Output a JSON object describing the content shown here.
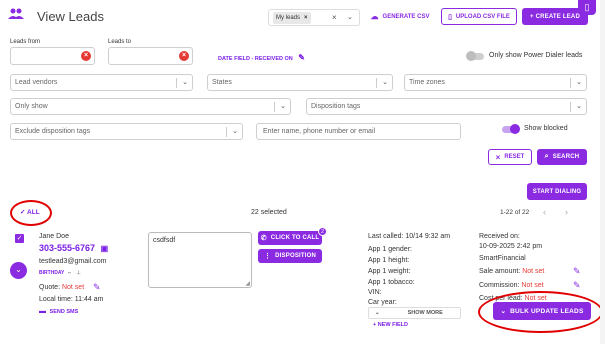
{
  "header": {
    "title": "View Leads",
    "list_chip": "My leads",
    "generate_csv": "GENERATE CSV",
    "upload_csv": "UPLOAD CSV FILE",
    "create_lead": "+ CREATE LEAD"
  },
  "filters": {
    "leads_from_label": "Leads from",
    "leads_to_label": "Leads to",
    "date_field": "DATE FIELD - RECEIVED ON",
    "power_dialer": "Only show Power Dialer leads",
    "lead_vendors": "Lead vendors",
    "states": "States",
    "time_zones": "Time zones",
    "only_show": "Only show",
    "disposition_tags": "Disposition tags",
    "exclude_tags": "Exclude disposition tags",
    "search_placeholder": "Enter name, phone number or email",
    "show_blocked": "Show blocked",
    "reset": "RESET",
    "search": "SEARCH"
  },
  "list": {
    "start_dialing": "START DIALING",
    "all": "ALL",
    "selected": "22 selected",
    "pagination": "1-22 of 22"
  },
  "lead": {
    "name": "Jane Doe",
    "phone": "303-555-6767",
    "email": "testlead3@gmail.com",
    "birthday_label": "BIRTHDAY",
    "birthday_value": "--",
    "quote_label": "Quote:",
    "quote_value": "Not set",
    "local_time": "Local time: 11:44 am",
    "send_sms": "SEND SMS",
    "note": "csdfsdf",
    "click_to_call": "CLICK TO CALL",
    "call_badge": "2",
    "disposition": "DISPOSITION",
    "last_called": "Last called: 10/14 9:32 am",
    "fields": [
      "App 1 gender:",
      "App 1 height:",
      "App 1 weight:",
      "App 1 tobacco:",
      "VIN:",
      "Car year:"
    ],
    "show_more": "SHOW MORE",
    "new_field": "+ NEW FIELD",
    "received_label": "Received on:",
    "received_value": "10-09-2025 2:42 pm",
    "vendor": "SmartFinancial",
    "sale_amount_label": "Sale amount:",
    "sale_amount_value": "Not set",
    "commission_label": "Commission:",
    "commission_value": "Not set",
    "cost_label": "Cost per lead:",
    "cost_value": "Not set"
  },
  "bulk_update": "BULK UPDATE LEADS",
  "colors": {
    "accent": "#8a2be2",
    "annotation": "#e00000",
    "notset": "#e53935"
  }
}
